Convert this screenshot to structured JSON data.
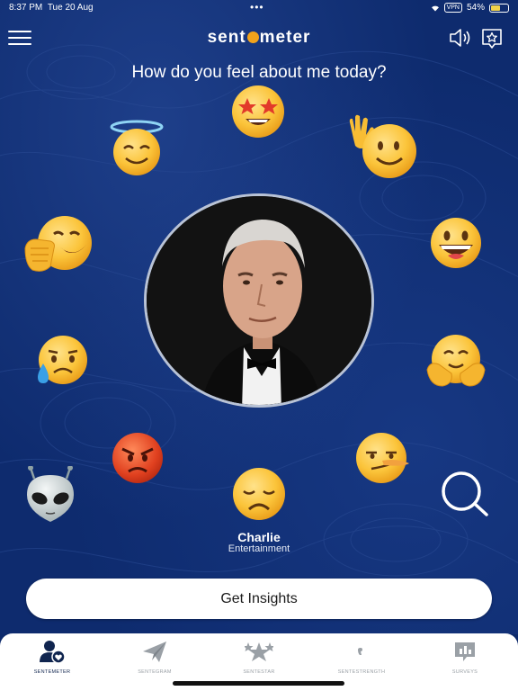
{
  "status_bar": {
    "time": "8:37 PM",
    "date": "Tue 20 Aug",
    "vpn": "VPN",
    "battery": "54%",
    "battery_level": 0.54
  },
  "header": {
    "logo_before": "sent",
    "logo_after": "meter",
    "menu_icon": "hamburger-menu-icon",
    "speaker_icon": "speaker-icon",
    "favorite_icon": "star-badge-icon"
  },
  "prompt": "How do you feel about me today?",
  "emojis": [
    "star-struck",
    "smiling-halo",
    "waving-smile",
    "hand-over-mouth",
    "grinning",
    "sad-tear",
    "hugging",
    "angry",
    "smirk",
    "alien",
    "disappointed"
  ],
  "person": {
    "name": "Charlie",
    "category": "Entertainment"
  },
  "insights_button": "Get Insights",
  "tabs": [
    {
      "label": "SENTEMETER",
      "icon": "person-heart-icon",
      "active": true
    },
    {
      "label": "SENTEGRAM",
      "icon": "paper-plane-icon",
      "active": false
    },
    {
      "label": "SENTESTAR",
      "icon": "stars-icon",
      "active": false
    },
    {
      "label": "SENTESTRENGTH",
      "icon": "quote-icon",
      "active": false
    },
    {
      "label": "SURVEYS",
      "icon": "chart-bubble-icon",
      "active": false
    }
  ],
  "colors": {
    "background": "#0e2b6e",
    "accent": "#f2a31b",
    "tab_active": "#10254f"
  }
}
